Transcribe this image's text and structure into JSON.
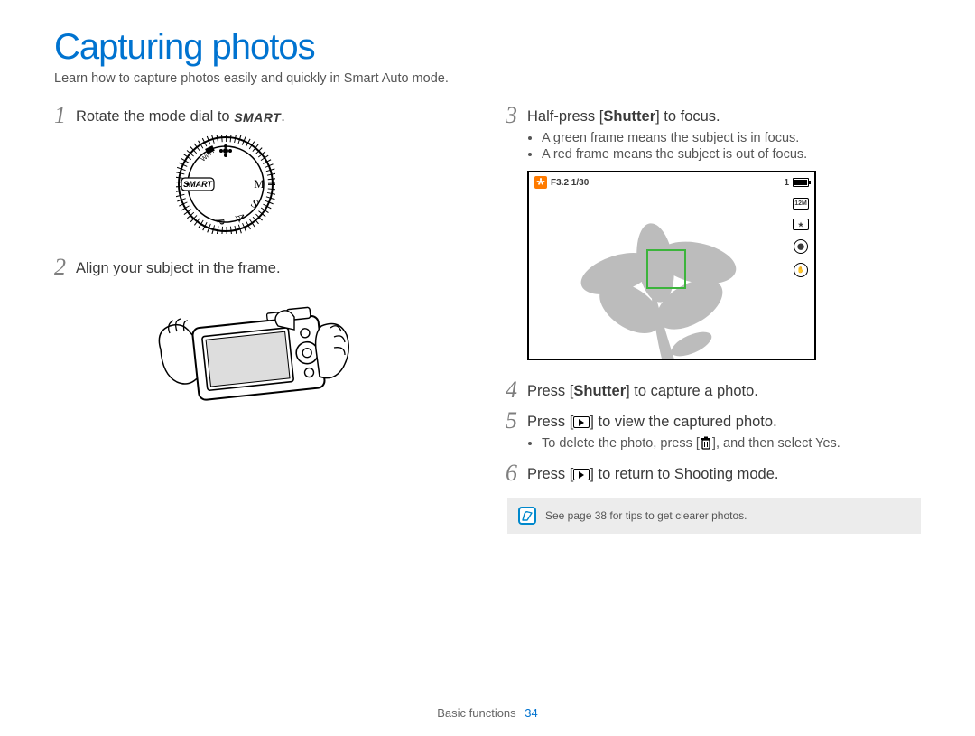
{
  "title": "Capturing photos",
  "subtitle": "Learn how to capture photos easily and quickly in Smart Auto mode.",
  "smart_label": "SMART",
  "dial_modes": [
    "Wi-Fi",
    "SMART",
    "M",
    "A",
    "S",
    "P"
  ],
  "steps": {
    "s1": {
      "num": "1",
      "pre": "Rotate the mode dial to ",
      "post": "."
    },
    "s2": {
      "num": "2",
      "text": "Align your subject in the frame."
    },
    "s3": {
      "num": "3",
      "pre": "Half-press [",
      "bold": "Shutter",
      "post": "] to focus.",
      "bullets": [
        "A green frame means the subject is in focus.",
        "A red frame means the subject is out of focus."
      ]
    },
    "s4": {
      "num": "4",
      "pre": "Press [",
      "bold": "Shutter",
      "post": "] to capture a photo."
    },
    "s5": {
      "num": "5",
      "pre": "Press [",
      "post": "] to view the captured photo.",
      "bullet_pre": "To delete the photo, press [",
      "bullet_mid": "], and then select ",
      "bullet_bold": "Yes",
      "bullet_post": "."
    },
    "s6": {
      "num": "6",
      "pre": "Press [",
      "post": "] to return to Shooting mode."
    }
  },
  "lcd": {
    "exposure": "F3.2  1/30",
    "count": "1",
    "sideIcons": [
      "12M",
      "★",
      "⬤",
      "✋"
    ]
  },
  "tip": "See page 38 for tips to get clearer photos.",
  "footer": {
    "section": "Basic functions",
    "page": "34"
  }
}
